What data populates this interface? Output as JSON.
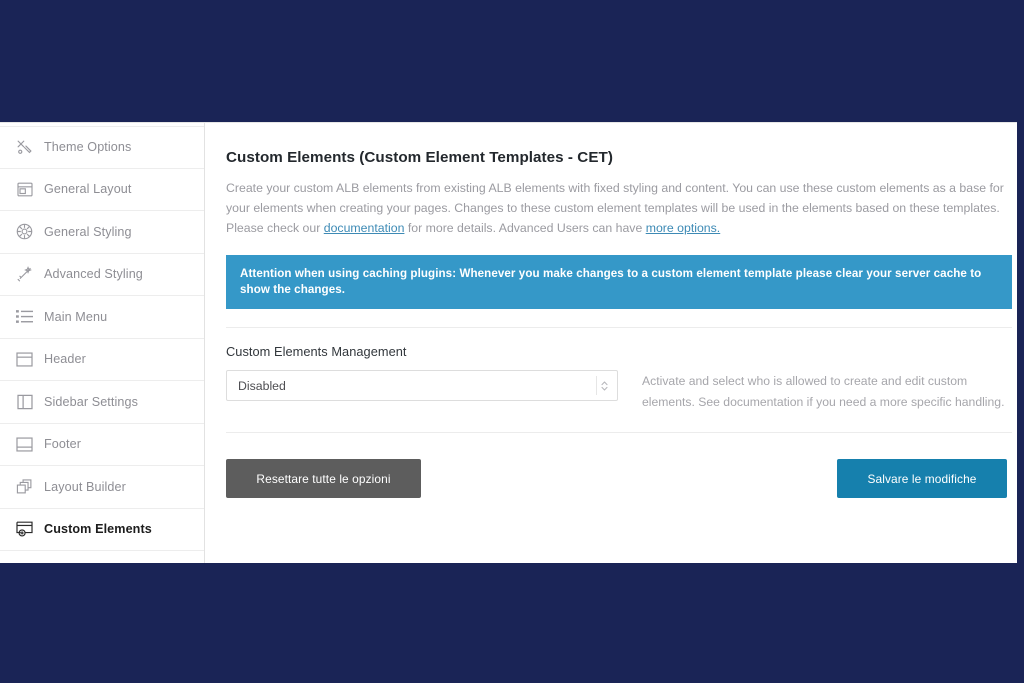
{
  "theme": {
    "navy": "#1a2456",
    "notice_blue": "#3598c8",
    "save_blue": "#1680ad",
    "reset_gray": "#5d5d5d",
    "link_blue": "#3d8ab5"
  },
  "sidebar": {
    "items": [
      {
        "label": "Theme Options",
        "icon": "tools-icon",
        "active": false
      },
      {
        "label": "General Layout",
        "icon": "layout-icon",
        "active": false
      },
      {
        "label": "General Styling",
        "icon": "palette-icon",
        "active": false
      },
      {
        "label": "Advanced Styling",
        "icon": "magic-wand-icon",
        "active": false
      },
      {
        "label": "Main Menu",
        "icon": "list-icon",
        "active": false
      },
      {
        "label": "Header",
        "icon": "header-box-icon",
        "active": false
      },
      {
        "label": "Sidebar Settings",
        "icon": "sidebar-panel-icon",
        "active": false
      },
      {
        "label": "Footer",
        "icon": "footer-box-icon",
        "active": false
      },
      {
        "label": "Layout Builder",
        "icon": "stacked-layers-icon",
        "active": false
      },
      {
        "label": "Custom Elements",
        "icon": "custom-element-icon",
        "active": true
      }
    ]
  },
  "main": {
    "title": "Custom Elements (Custom Element Templates - CET)",
    "description": {
      "part1": "Create your custom ALB elements from existing ALB elements with fixed styling and content. You can use these custom elements as a base for your elements when creating your pages. Changes to these custom element templates will be used in the elements based on these templates. Please check our ",
      "link1": "documentation",
      "part2": " for more details. Advanced Users can have ",
      "link2": "more options.",
      "part3": ""
    },
    "notice": "Attention when using caching plugins: Whenever you make changes to a custom element template please clear your server cache to show the changes.",
    "field": {
      "label": "Custom Elements Management",
      "select_value": "Disabled",
      "help_text": "Activate and select who is allowed to create and edit custom elements. See documentation if you need a more specific handling."
    },
    "actions": {
      "reset_label": "Resettare tutte le opzioni",
      "save_label": "Salvare le modifiche"
    }
  }
}
